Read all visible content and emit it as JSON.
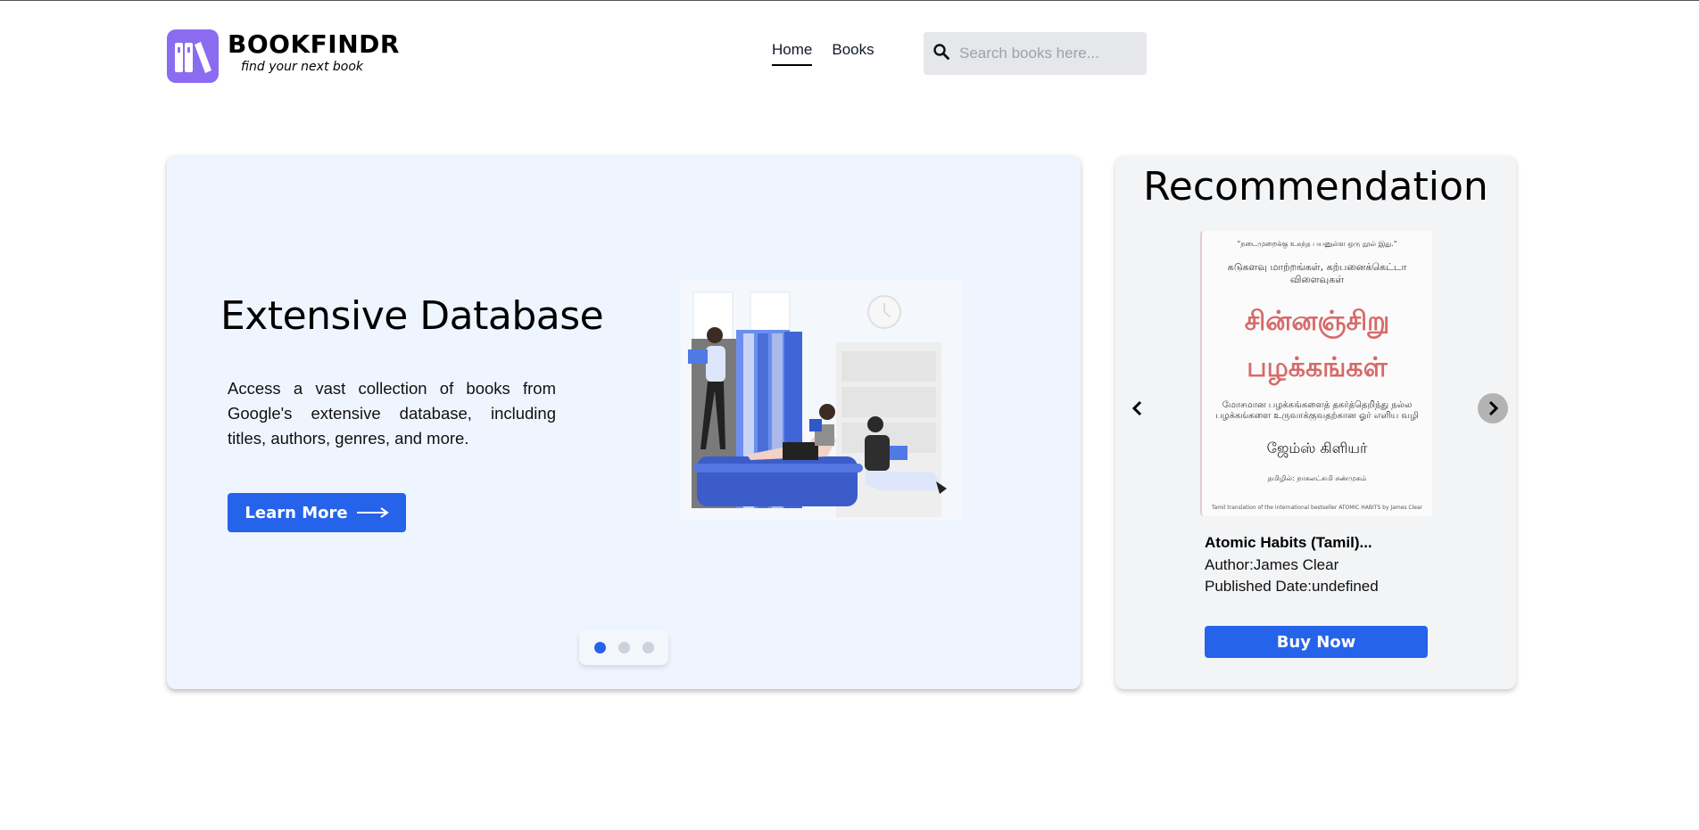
{
  "header": {
    "brand": "BOOKFINDR",
    "tagline": "find your next book",
    "logo_color": "#8b6cf0",
    "nav": [
      {
        "label": "Home",
        "active": true
      },
      {
        "label": "Books",
        "active": false
      }
    ],
    "search": {
      "placeholder": "Search books here...",
      "value": "",
      "icon": "search-icon"
    }
  },
  "hero": {
    "title": "Extensive Database",
    "description": "Access a vast collection of books from Google's extensive database, including titles, authors, genres, and more.",
    "button_label": "Learn More",
    "button_icon": "arrow-right-icon",
    "slides_total": 3,
    "active_slide": 1,
    "illustration": "people-reading-books-illustration"
  },
  "recommendation": {
    "title": "Recommendation",
    "book": {
      "title": "Atomic Habits (Tamil)...",
      "author": "Author:James Clear",
      "published": "Published Date:undefined",
      "cover": {
        "top_quote": "\"நடைமுறைக்கு உகந்த பயனுள்ள ஒரு நூல் இது.\"",
        "subtitle": "கடுகளவு மாற்றங்கள், கற்பனைக்கெட்டா விளைவுகள்",
        "main_title_1": "சின்னஞ்சிறு",
        "main_title_2": "பழக்கங்கள்",
        "description": "மோசமான பழக்கங்களைத் தகர்த்தெறிந்து நல்ல பழக்கங்களை உருவாக்குவதற்கான ஓர் எளிய வழி",
        "author": "ஜேம்ஸ் கிளியர்",
        "translator": "தமிழில்: நாகலட்சுமி சண்முகம்",
        "footer": "Tamil translation of the international bestseller ATOMIC HABITS by James Clear"
      }
    },
    "buy_label": "Buy Now",
    "prev_icon": "chevron-left-icon",
    "next_icon": "chevron-right-icon"
  },
  "colors": {
    "primary": "#2563eb",
    "hero_bg": "#eff5ff",
    "card_bg": "#f3f4f6"
  }
}
